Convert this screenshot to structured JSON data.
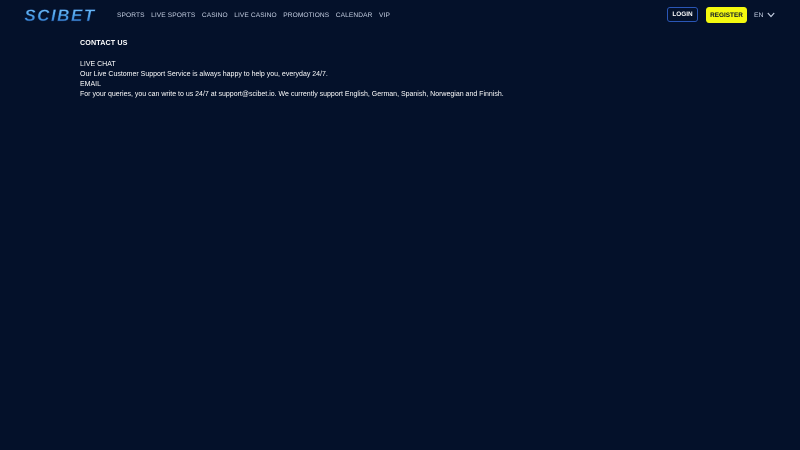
{
  "header": {
    "logo_text": "SCIBET",
    "nav": [
      {
        "label": "SPORTS"
      },
      {
        "label": "LIVE SPORTS"
      },
      {
        "label": "CASINO"
      },
      {
        "label": "LIVE CASINO"
      },
      {
        "label": "PROMOTIONS"
      },
      {
        "label": "CALENDAR"
      },
      {
        "label": "VIP"
      }
    ],
    "login_label": "LOGIN",
    "register_label": "REGISTER",
    "language": "EN"
  },
  "content": {
    "title": "CONTACT US",
    "live_chat_heading": "LIVE CHAT",
    "live_chat_text": "Our Live Customer Support Service is always happy to help you, everyday 24/7.",
    "email_heading": "EMAIL",
    "email_text": "For your queries, you can write to us 24/7 at support@scibet.io. We currently support English, German, Spanish, Norwegian and Finnish."
  },
  "colors": {
    "background": "#04112a",
    "register_accent": "#f4f90f",
    "login_border": "#2a56b6",
    "logo_blue": "#4fa3e8"
  }
}
